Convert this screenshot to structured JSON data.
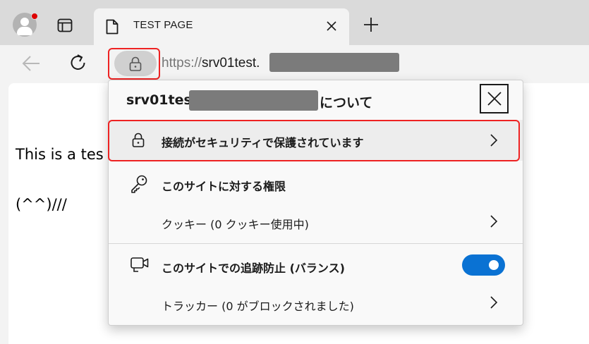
{
  "tab": {
    "title": "TEST PAGE"
  },
  "address": {
    "scheme": "https://",
    "host": "srv01test."
  },
  "page": {
    "line1": "This is a tes",
    "line2": "(^^)///"
  },
  "popup": {
    "host": "srv01test.",
    "header_suffix": "について",
    "connection_label": "接続がセキュリティで保護されています",
    "permissions_label": "このサイトに対する権限",
    "cookies_label": "クッキー (0 クッキー使用中)",
    "tracking_label": "このサイトでの追跡防止 (バランス)",
    "tracking_enabled": true,
    "trackers_label": "トラッカー (0 がブロックされました)"
  },
  "icons": {
    "profile": "avatar-icon",
    "tab_actions": "tab-actions-icon",
    "page": "page-icon",
    "close": "close-icon",
    "new_tab": "plus-icon",
    "back": "back-arrow-icon",
    "refresh": "refresh-icon",
    "lock": "lock-icon",
    "key": "key-icon",
    "camera": "camera-icon",
    "chevron": "chevron-right-icon"
  },
  "colors": {
    "accent": "#0a72d3",
    "highlight": "#e22222",
    "redaction": "#7b7b7b"
  }
}
